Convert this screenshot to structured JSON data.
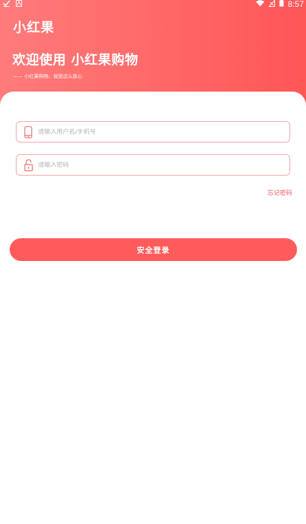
{
  "status_bar": {
    "time": "8:57",
    "left_icons": [
      "check-icon",
      "a-badge-icon"
    ],
    "right_icons": [
      "wifi-icon",
      "signal-icon",
      "battery-icon"
    ]
  },
  "header": {
    "app_name": "小红果",
    "welcome": "欢迎使用 小红果购物",
    "slogan": "—— 小红果购物，就是这么放心"
  },
  "form": {
    "username_placeholder": "请输入用户名/手机号",
    "username_value": "",
    "password_placeholder": "请输入密码",
    "password_value": "",
    "forgot_label": "忘记密码",
    "login_label": "安全登录"
  },
  "colors": {
    "primary": "#ff5b5b",
    "gradient_start": "#ff7b7b",
    "gradient_end": "#ff5656",
    "field_border": "#f5a5a5",
    "link": "#ec5a5a"
  }
}
